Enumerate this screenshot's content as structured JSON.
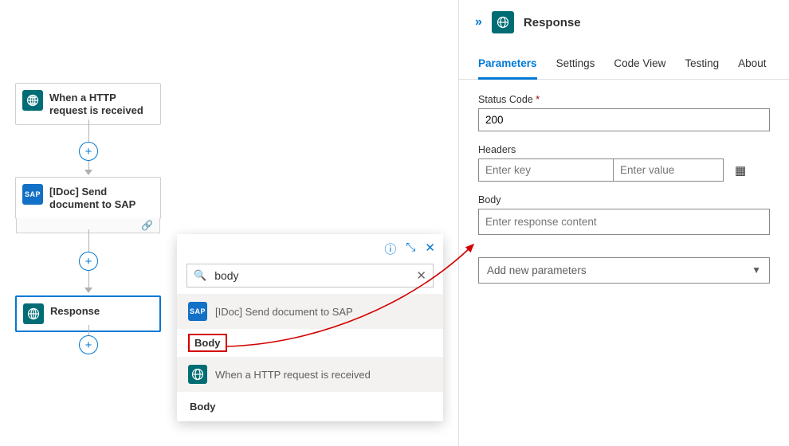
{
  "workflow": {
    "nodes": [
      {
        "label": "When a HTTP request is received"
      },
      {
        "label": "[IDoc] Send document to SAP"
      },
      {
        "label": "Response"
      }
    ]
  },
  "picker": {
    "search_value": "body",
    "groups": [
      {
        "title": "[IDoc] Send document to SAP",
        "items": [
          "Body"
        ]
      },
      {
        "title": "When a HTTP request is received",
        "items": [
          "Body"
        ]
      }
    ]
  },
  "panel": {
    "title": "Response",
    "tabs": [
      "Parameters",
      "Settings",
      "Code View",
      "Testing",
      "About"
    ],
    "active_tab": 0,
    "fields": {
      "status_label": "Status Code",
      "status_value": "200",
      "headers_label": "Headers",
      "headers_key_placeholder": "Enter key",
      "headers_val_placeholder": "Enter value",
      "body_label": "Body",
      "body_placeholder": "Enter response content",
      "add_params": "Add new parameters"
    }
  }
}
